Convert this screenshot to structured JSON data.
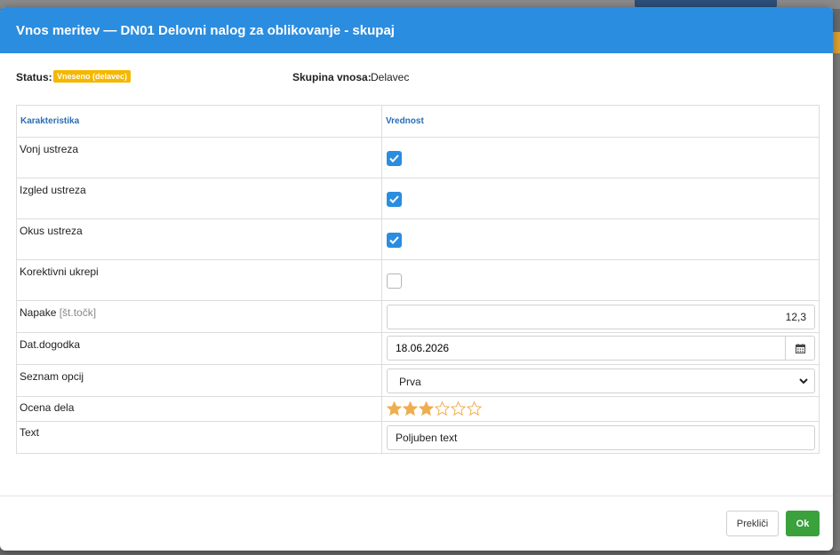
{
  "modal": {
    "title": "Vnos meritev — DN01 Delovni nalog za oblikovanje - skupaj",
    "status_label": "Status:",
    "status_value": "Vneseno (delavec)",
    "group_label": "Skupina vnosa:",
    "group_value": "Delavec"
  },
  "table": {
    "headers": [
      "Karakteristika",
      "Vrednost"
    ],
    "rows": [
      {
        "label": "Vonj ustreza",
        "type": "checkbox",
        "checked": true
      },
      {
        "label": "Izgled ustreza",
        "type": "checkbox",
        "checked": true
      },
      {
        "label": "Okus ustreza",
        "type": "checkbox",
        "checked": true
      },
      {
        "label": "Korektivni ukrepi",
        "type": "checkbox",
        "checked": false
      },
      {
        "label": "Napake",
        "unit": "[št.točk]",
        "type": "number",
        "value": "12,3"
      },
      {
        "label": "Dat.dogodka",
        "type": "date",
        "value": "18.06.2026"
      },
      {
        "label": "Seznam opcij",
        "type": "select",
        "value": "Prva"
      },
      {
        "label": "Ocena dela",
        "type": "rating",
        "rating": 3,
        "max": 6
      },
      {
        "label": "Text",
        "type": "text",
        "value": "Poljuben text"
      }
    ]
  },
  "footer": {
    "cancel_label": "Prekliči",
    "ok_label": "Ok"
  },
  "colors": {
    "header_bg": "#2a8de0",
    "badge_bg": "#f5b700",
    "ok_bg": "#3aa13d",
    "star": "#f0ad4e"
  },
  "icons": {
    "checkbox_check": "check-icon",
    "date_button": "calendar-icon",
    "select_arrow": "chevron-down-icon",
    "rating": "star-icon"
  }
}
